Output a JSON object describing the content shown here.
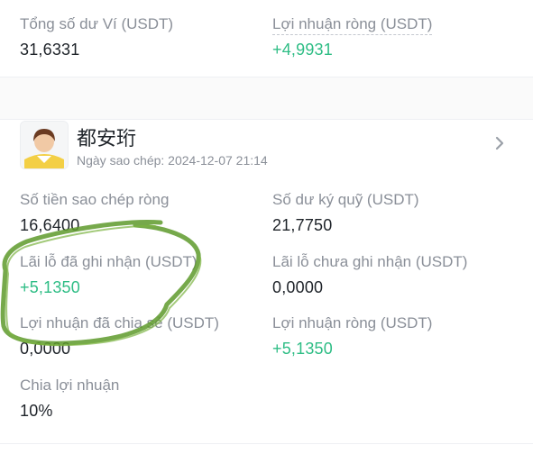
{
  "summary": {
    "total_balance_label": "Tổng số dư Ví (USDT)",
    "total_balance_value": "31,6331",
    "net_profit_label": "Lợi nhuận ròng (USDT)",
    "net_profit_value": "+4,9931"
  },
  "trader": {
    "name": "都安珩",
    "copy_date": "Ngày sao chép: 2024-12-07 21:14",
    "avatar_icon": "user-avatar-icon",
    "detail_icon": "chevron-right-icon"
  },
  "stats": {
    "net_copy_amount_label": "Số tiền sao chép ròng",
    "net_copy_amount_value": "16,6400",
    "margin_balance_label": "Số dư ký quỹ (USDT)",
    "margin_balance_value": "21,7750",
    "realized_pnl_label": "Lãi lỗ đã ghi nhận (USDT)",
    "realized_pnl_value": "+5,1350",
    "unrealized_pnl_label": "Lãi lỗ chưa ghi nhận (USDT)",
    "unrealized_pnl_value": "0,0000",
    "shared_profit_label": "Lợi nhuận đã chia sẻ (USDT)",
    "shared_profit_value": "0,0000",
    "net_profit_label": "Lợi nhuận ròng (USDT)",
    "net_profit_value": "+5,1350",
    "profit_share_label": "Chia lợi nhuận",
    "profit_share_value": "10%"
  },
  "colors": {
    "positive": "#2ebd85",
    "label": "#8a8f98",
    "text": "#1e2329",
    "annotation_marker": "#5e9a2c"
  }
}
